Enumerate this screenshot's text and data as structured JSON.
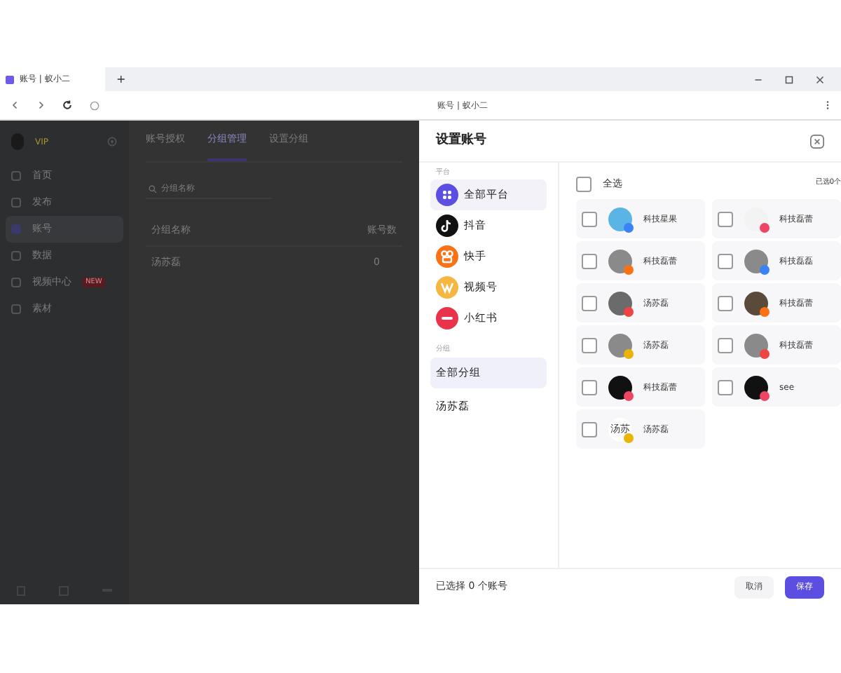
{
  "browser": {
    "tab_title": "账号 | 蚁小二",
    "new_tab": "+",
    "address": "账号 | 蚁小二"
  },
  "app": {
    "user_badge": "VIP",
    "nav": [
      {
        "label": "首页",
        "selected": false
      },
      {
        "label": "发布",
        "selected": false
      },
      {
        "label": "账号",
        "selected": true
      },
      {
        "label": "数据",
        "selected": false
      },
      {
        "label": "视频中心",
        "selected": false,
        "badge": "NEW"
      },
      {
        "label": "素材",
        "selected": false
      }
    ],
    "tabs": [
      {
        "label": "账号授权",
        "selected": false
      },
      {
        "label": "分组管理",
        "selected": true
      },
      {
        "label": "设置分组",
        "selected": false
      }
    ],
    "search": {
      "placeholder": "分组名称"
    },
    "table": {
      "columns": [
        "分组名称",
        "账号数"
      ],
      "rows": [
        [
          "汤苏磊",
          "0"
        ]
      ]
    }
  },
  "dialog": {
    "title": "设置账号",
    "platform_heading": "平台",
    "platforms": [
      {
        "label": "全部平台",
        "kind": "all",
        "selected": true
      },
      {
        "label": "抖音",
        "kind": "douyin",
        "selected": false
      },
      {
        "label": "快手",
        "kind": "kuaishou",
        "selected": false
      },
      {
        "label": "视频号",
        "kind": "channels",
        "selected": false
      },
      {
        "label": "小红书",
        "kind": "xhs",
        "selected": false
      }
    ],
    "group_heading": "分组",
    "groups": [
      {
        "label": "全部分组",
        "selected": true
      },
      {
        "label": "汤苏磊",
        "selected": false
      }
    ],
    "select_all": {
      "label": "全选",
      "checked": false
    },
    "selected_count": "已选0个",
    "accounts": [
      {
        "name": "科技星果",
        "checked": false,
        "color": "#3b82f6"
      },
      {
        "name": "科技磊蕾",
        "checked": false,
        "color": "#ef4565"
      },
      {
        "name": "科技磊蕾",
        "checked": false,
        "color": "#f97316"
      },
      {
        "name": "科技磊磊",
        "checked": false,
        "color": "#3b82f6"
      },
      {
        "name": "汤苏磊",
        "checked": false,
        "color": "#ef4444"
      },
      {
        "name": "科技磊蕾",
        "checked": false,
        "color": "#f97316"
      },
      {
        "name": "汤苏磊",
        "checked": false,
        "color": "#eab308"
      },
      {
        "name": "科技磊蕾",
        "checked": false,
        "color": "#ef4444"
      },
      {
        "name": "科技磊蕾",
        "checked": false,
        "color": "#ef4565"
      },
      {
        "name": "see",
        "checked": false,
        "color": "#ef4565"
      },
      {
        "name": "汤苏磊",
        "checked": false,
        "avatar_text": "汤苏",
        "color": "#eab308"
      }
    ],
    "footer_text": "已选择 0 个账号",
    "cancel": "取消",
    "save": "保存"
  }
}
